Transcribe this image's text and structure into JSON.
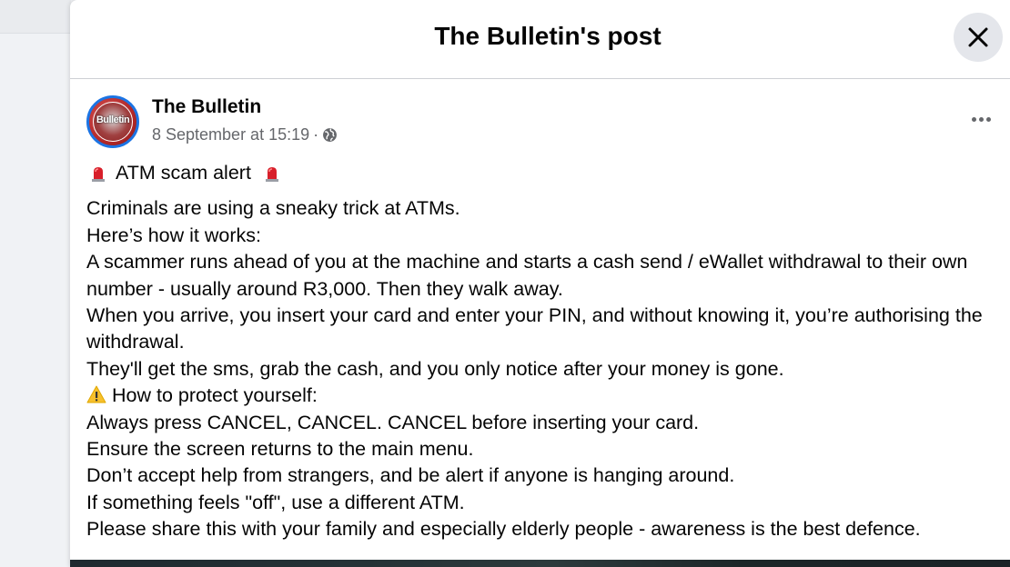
{
  "dialog": {
    "title": "The Bulletin's post",
    "close_icon": "close-icon"
  },
  "post": {
    "author": "The Bulletin",
    "avatar_text": "Bulletin",
    "timestamp": "8 September at 15:19",
    "separator": "·",
    "audience_icon": "globe-icon",
    "more_icon": "more-options-icon",
    "alert_title": "ATM scam alert",
    "lines": [
      "Criminals are using a sneaky trick at ATMs.",
      "Here’s how it works:",
      "A scammer runs ahead of you at the machine and starts a cash send / eWallet withdrawal to their own number - usually around R3,000. Then they walk away.",
      "When you arrive, you insert your card and enter your PIN, and without knowing it, you’re authorising the withdrawal.",
      "They'll get the sms, grab the cash, and you only notice after your money is gone."
    ],
    "protect_heading": "How to protect yourself:",
    "tips": [
      "Always press CANCEL, CANCEL. CANCEL before inserting your card.",
      "Ensure the screen returns to the main menu.",
      "Don’t accept help from strangers, and be alert if anyone is hanging around.",
      "If something feels \"off\", use a different ATM.",
      "Please share this with your family and especially elderly people - awareness is the best defence."
    ]
  },
  "colors": {
    "accent": "#1b74e4",
    "secondary_text": "#65676b",
    "alert_red": "#d81f2a",
    "warning_yellow": "#f7c02d"
  }
}
